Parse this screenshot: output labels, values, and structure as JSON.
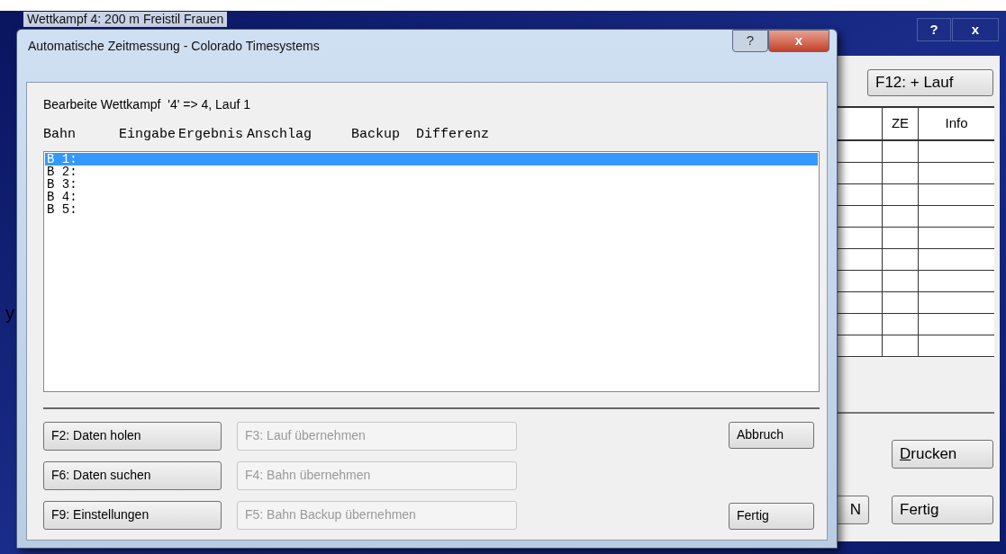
{
  "outer_window": {
    "title": "Wettkampf 4: 200 m Freistil Frauen",
    "title_buttons": [
      "?",
      "x"
    ],
    "add_heat_button": "F12: + Lauf",
    "table": {
      "columns": [
        "ZE",
        "Info"
      ]
    },
    "print_button": {
      "label": "Drucken",
      "underline_first": true
    },
    "partial_button": "N",
    "done_button": "Fertig"
  },
  "edge_text": "y",
  "dialog": {
    "title": "Automatische Zeitmessung - Colorado Timesystems",
    "title_buttons": [
      "?",
      "x"
    ],
    "heading": "Bearbeite Wettkampf  '4' => 4, Lauf 1",
    "columns": [
      "Bahn",
      "Eingabe",
      "Ergebnis",
      "Anschlag",
      "Backup",
      "Differenz"
    ],
    "lanes": [
      {
        "label": "B 1:",
        "selected": true
      },
      {
        "label": "B 2:",
        "selected": false
      },
      {
        "label": "B 3:",
        "selected": false
      },
      {
        "label": "B 4:",
        "selected": false
      },
      {
        "label": "B 5:",
        "selected": false
      }
    ],
    "left_buttons": [
      "F2: Daten holen",
      "F6: Daten suchen",
      "F9: Einstellungen"
    ],
    "middle_buttons": [
      {
        "label": "F3: Lauf übernehmen",
        "disabled": true
      },
      {
        "label": "F4: Bahn übernehmen",
        "disabled": true
      },
      {
        "label": "F5: Bahn Backup übernehmen",
        "disabled": true
      }
    ],
    "cancel_button": "Abbruch",
    "done_button": "Fertig"
  }
}
